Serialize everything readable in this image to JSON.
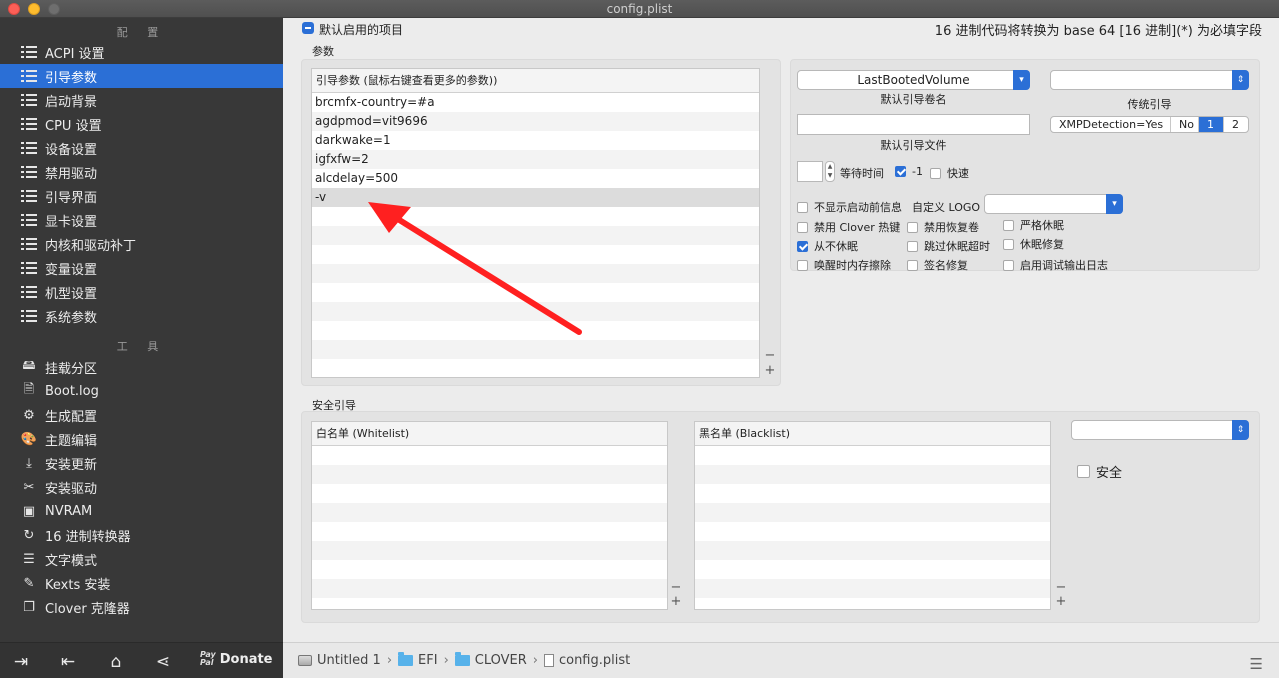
{
  "window": {
    "title": "config.plist"
  },
  "sidebar": {
    "config_header": "配 置",
    "tools_header": "工 具",
    "config_items": [
      {
        "label": "ACPI 设置",
        "icon": "list-icon"
      },
      {
        "label": "引导参数",
        "icon": "list-icon",
        "active": true
      },
      {
        "label": "启动背景",
        "icon": "list-icon"
      },
      {
        "label": "CPU 设置",
        "icon": "list-icon"
      },
      {
        "label": "设备设置",
        "icon": "list-icon"
      },
      {
        "label": "禁用驱动",
        "icon": "list-icon"
      },
      {
        "label": "引导界面",
        "icon": "list-icon"
      },
      {
        "label": "显卡设置",
        "icon": "list-icon"
      },
      {
        "label": "内核和驱动补丁",
        "icon": "list-icon"
      },
      {
        "label": "变量设置",
        "icon": "list-icon"
      },
      {
        "label": "机型设置",
        "icon": "list-icon"
      },
      {
        "label": "系统参数",
        "icon": "list-icon"
      }
    ],
    "tool_items": [
      {
        "label": "挂载分区",
        "icon": "disk-icon"
      },
      {
        "label": "Boot.log",
        "icon": "log-icon"
      },
      {
        "label": "生成配置",
        "icon": "gears-icon"
      },
      {
        "label": "主题编辑",
        "icon": "palette-icon"
      },
      {
        "label": "安装更新",
        "icon": "download-icon"
      },
      {
        "label": "安装驱动",
        "icon": "wrench-icon"
      },
      {
        "label": "NVRAM",
        "icon": "chip-icon"
      },
      {
        "label": "16 进制转换器",
        "icon": "refresh-icon"
      },
      {
        "label": "文字模式",
        "icon": "text-icon"
      },
      {
        "label": "Kexts 安装",
        "icon": "plug-icon"
      },
      {
        "label": "Clover 克隆器",
        "icon": "clone-icon"
      }
    ],
    "bottom": {
      "donate_label": "Donate",
      "paypal_top": "Pay",
      "paypal_bottom": "Pal"
    }
  },
  "main": {
    "default_enabled_label": "默认启用的项目",
    "hex_note": "16 进制代码将转换为 base 64 [16 进制](*) 为必填字段",
    "params_group_label": "参数",
    "boot_args_header": "引导参数 (鼠标右键查看更多的参数))",
    "boot_args": [
      "brcmfx-country=#a",
      "agdpmod=vit9696",
      "darkwake=1",
      "igfxfw=2",
      "alcdelay=500",
      "-v"
    ],
    "default_volume_value": "LastBootedVolume",
    "default_volume_caption": "默认引导卷名",
    "legacy_caption": "传统引导",
    "legacy_value": "",
    "default_loader_caption": "默认引导文件",
    "default_loader_value": "",
    "xmp": {
      "options": [
        "XMPDetection=Yes",
        "No",
        "1",
        "2"
      ],
      "selected": "1"
    },
    "timeout_label": "等待时间",
    "timeout_value": "",
    "minus_one_label": "-1",
    "fast_label": "快速",
    "no_early_progress_label": "不显示启动前信息",
    "custom_logo_label": "自定义 LOGO",
    "custom_logo_value": "",
    "checkboxes": {
      "disable_clover_hotkeys": "禁用 Clover 热键",
      "disable_recovery": "禁用恢复卷",
      "strict_hibernate": "严格休眠",
      "never_hibernate": "从不休眠",
      "skip_hibernate_timeout": "跳过休眠超时",
      "hibernate_fix": "休眠修复",
      "rtc_hibernate_aware": "唤醒时内存擦除",
      "signature_fix": "签名修复",
      "debug_log": "启用调试输出日志"
    },
    "secure_boot_group_label": "安全引导",
    "whitelist_header": "白名单 (Whitelist)",
    "blacklist_header": "黑名单 (Blacklist)",
    "secure_label": "安全",
    "secure_popup_value": ""
  },
  "pathbar": {
    "items": [
      "Untitled 1",
      "EFI",
      "CLOVER",
      "config.plist"
    ],
    "separator": "›"
  },
  "colors": {
    "accent": "#2b6fd6",
    "sidebar_bg": "#383838",
    "main_bg": "#ececec",
    "arrow": "#ff2020"
  }
}
